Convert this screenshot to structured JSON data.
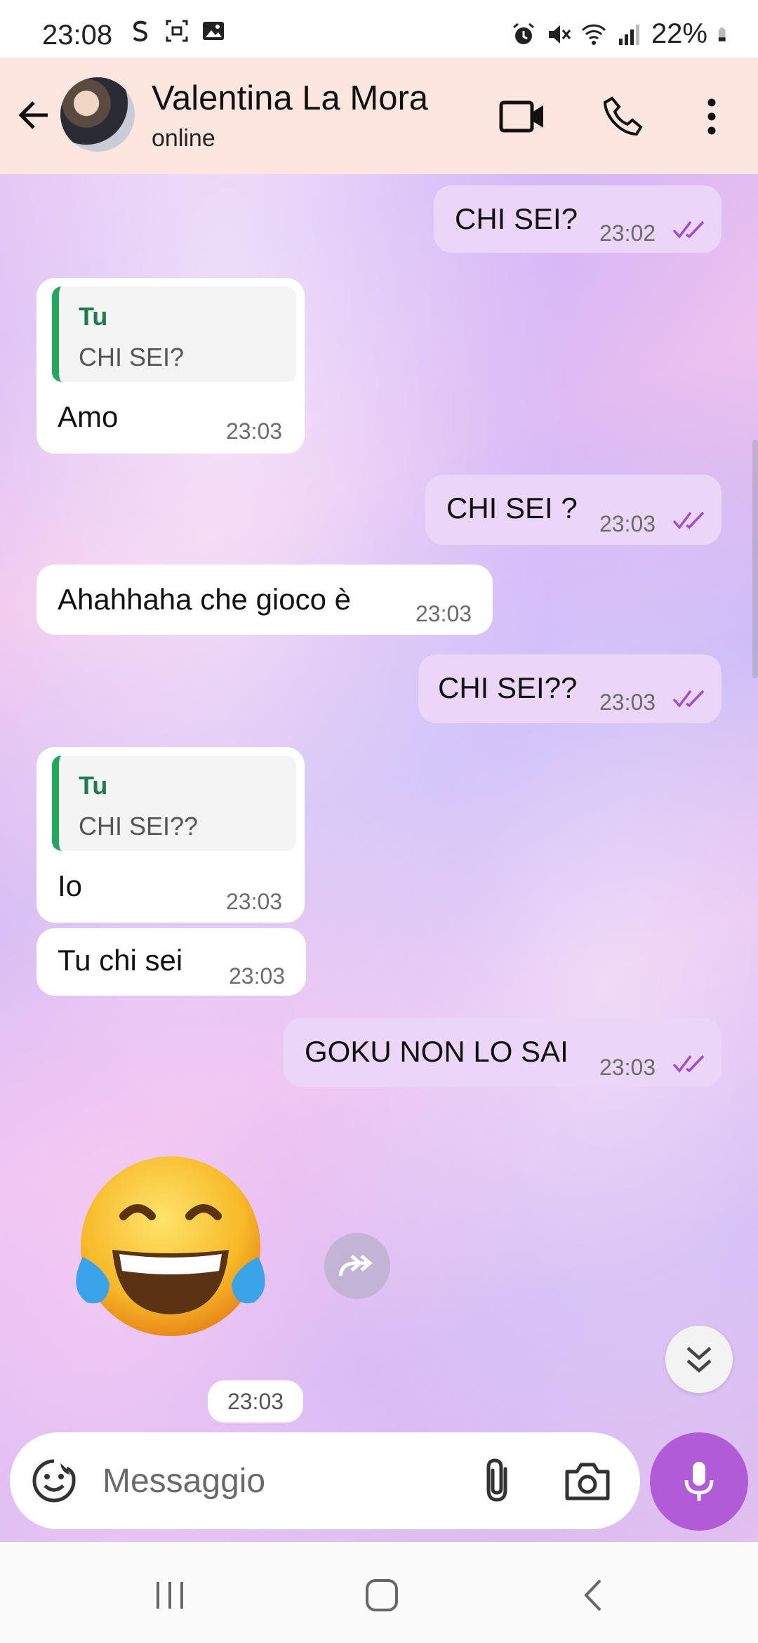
{
  "status_bar": {
    "time": "23:08",
    "battery": "22%",
    "icons": [
      "s-icon",
      "screenshot-icon",
      "gallery-icon",
      "alarm-icon",
      "mute-icon",
      "wifi-icon",
      "signal-icon",
      "battery-icon"
    ]
  },
  "header": {
    "contact_name": "Valentina La Mora",
    "contact_status": "online",
    "icons": [
      "back-arrow-icon",
      "video-call-icon",
      "phone-icon",
      "more-vert-icon"
    ]
  },
  "messages": [
    {
      "id": "m1",
      "direction": "out",
      "text": "CHI SEI?",
      "time": "23:02",
      "read": true
    },
    {
      "id": "m2",
      "direction": "in",
      "quote_author": "Tu",
      "quote_text": "CHI SEI?",
      "text": "Amo",
      "time": "23:03"
    },
    {
      "id": "m3",
      "direction": "out",
      "text": "CHI SEI ?",
      "time": "23:03",
      "read": true
    },
    {
      "id": "m4",
      "direction": "in",
      "text": "Ahahhaha che gioco è",
      "time": "23:03"
    },
    {
      "id": "m5",
      "direction": "out",
      "text": "CHI SEI??",
      "time": "23:03",
      "read": true
    },
    {
      "id": "m6",
      "direction": "in",
      "quote_author": "Tu",
      "quote_text": "CHI SEI??",
      "text": "Io",
      "time": "23:03"
    },
    {
      "id": "m7",
      "direction": "in",
      "text": "Tu chi sei",
      "time": "23:03"
    },
    {
      "id": "m8",
      "direction": "out",
      "text": "GOKU NON LO SAI",
      "time": "23:03",
      "read": true
    },
    {
      "id": "m9",
      "direction": "in",
      "emoji": "face-with-tears-of-joy",
      "time": "23:03"
    }
  ],
  "composer": {
    "placeholder": "Messaggio",
    "icons": [
      "sticker-icon",
      "attach-icon",
      "camera-icon",
      "mic-icon"
    ]
  },
  "colors": {
    "header_bg": "#fde6df",
    "outgoing_bubble": "#ecd6f7",
    "incoming_bubble": "#ffffff",
    "read_ticks": "#a44ad1",
    "quote_bar": "#25a55f",
    "mic_button": "#b25bd8"
  }
}
